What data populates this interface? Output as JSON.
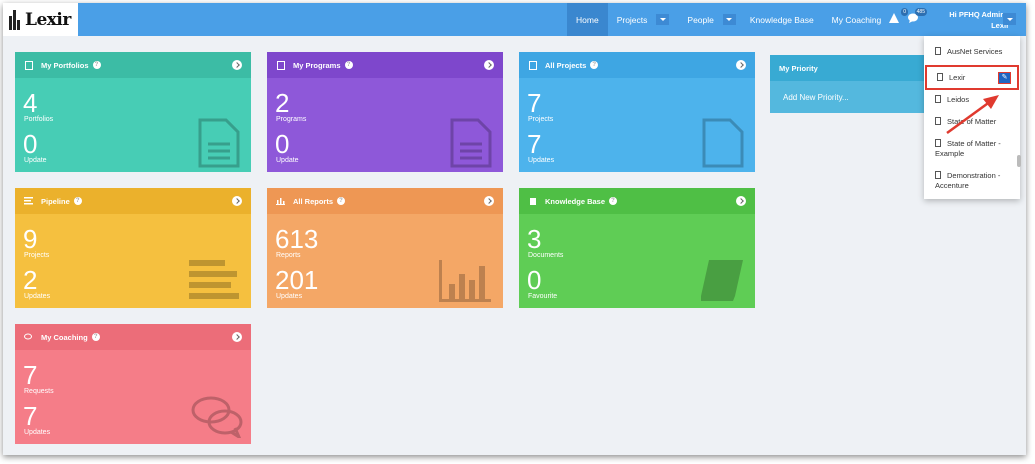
{
  "app": {
    "logo_text": "Lexir"
  },
  "nav": {
    "home": "Home",
    "projects": "Projects",
    "people": "People",
    "knowledge_base": "Knowledge Base",
    "my_coaching": "My Coaching",
    "alerts_count": "0",
    "messages_count": "485"
  },
  "user": {
    "greeting": "Hi PFHQ Admin ,",
    "org": "Lexir"
  },
  "cards": {
    "portfolios": {
      "title": "My Portfolios",
      "n1": "4",
      "l1": "Portfolios",
      "n2": "0",
      "l2": "Update",
      "color": "#47cdb5"
    },
    "programs": {
      "title": "My Programs",
      "n1": "2",
      "l1": "Programs",
      "n2": "0",
      "l2": "Update",
      "color": "#8e58d9"
    },
    "projects": {
      "title": "All Projects",
      "n1": "7",
      "l1": "Projects",
      "n2": "7",
      "l2": "Updates",
      "color": "#4db3ec"
    },
    "pipeline": {
      "title": "Pipeline",
      "n1": "9",
      "l1": "Projects",
      "n2": "2",
      "l2": "Updates",
      "color": "#f5c03f"
    },
    "reports": {
      "title": "All Reports",
      "n1": "613",
      "l1": "Reports",
      "n2": "201",
      "l2": "Updates",
      "color": "#f4a766"
    },
    "knowledge": {
      "title": "Knowledge Base",
      "n1": "3",
      "l1": "Documents",
      "n2": "0",
      "l2": "Favourite",
      "color": "#5fcd55"
    },
    "coaching": {
      "title": "My Coaching",
      "n1": "7",
      "l1": "Requests",
      "n2": "7",
      "l2": "Updates",
      "color": "#f57d88"
    }
  },
  "priority": {
    "title": "My Priority",
    "add_new": "Add New Priority..."
  },
  "org_dropdown": {
    "items": [
      "AusNet Services",
      "Lexir",
      "Leidos",
      "State of Matter",
      "State of Matter - Example",
      "Demonstration - Accenture"
    ],
    "selected": "Lexir"
  }
}
